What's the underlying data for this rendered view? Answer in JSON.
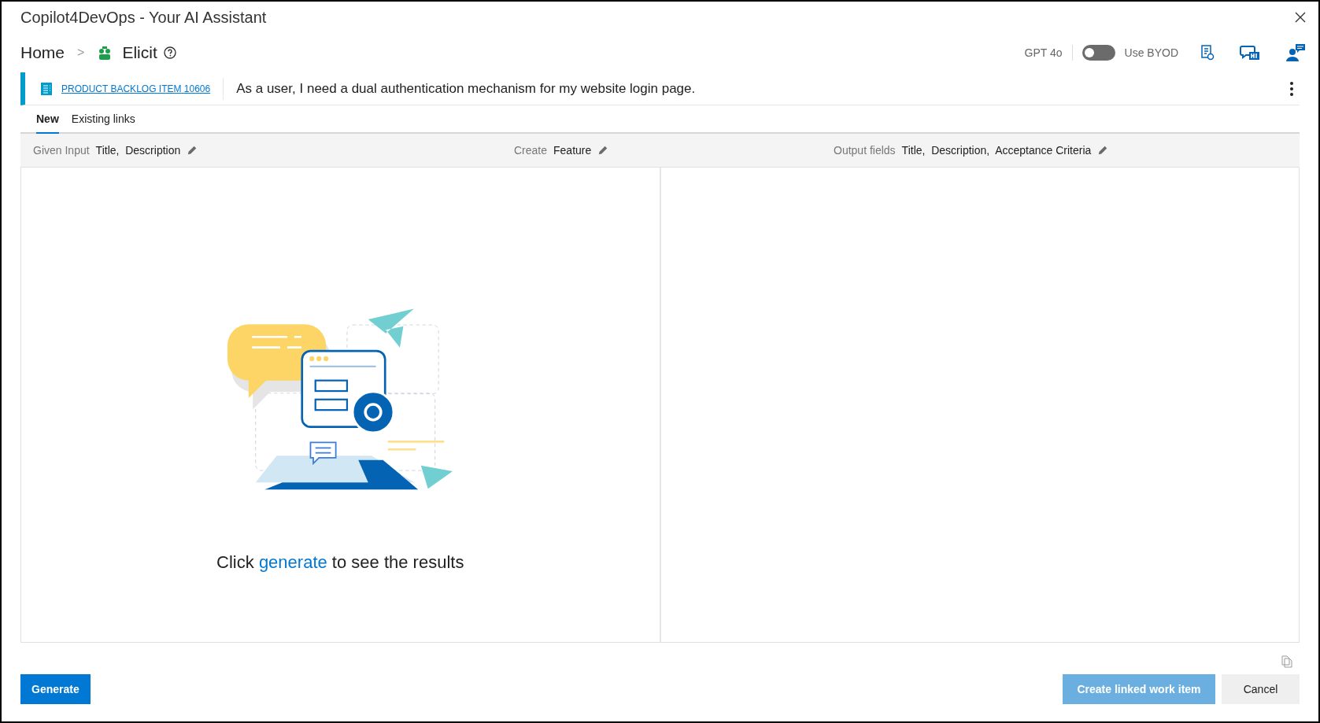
{
  "window": {
    "title": "Copilot4DevOps - Your AI Assistant"
  },
  "breadcrumb": {
    "home": "Home",
    "separator": ">",
    "current": "Elicit"
  },
  "header_right": {
    "model": "GPT 4o",
    "byod_toggle": {
      "on": false,
      "label": "Use BYOD"
    }
  },
  "work_item": {
    "link": "PRODUCT BACKLOG ITEM 10606",
    "title": "As a user, I need a dual authentication mechanism for my website login page."
  },
  "tabs": [
    {
      "label": "New",
      "selected": true
    },
    {
      "label": "Existing links",
      "selected": false
    }
  ],
  "config_bar": [
    {
      "label": "Given Input",
      "value": "Title,  Description"
    },
    {
      "label": "Create",
      "value": "Feature"
    },
    {
      "label": "Output fields",
      "value": "Title,  Description,  Acceptance Criteria"
    }
  ],
  "empty_state": {
    "before": "Click ",
    "link": "generate",
    "after": " to see the results"
  },
  "buttons": {
    "generate": "Generate",
    "create_linked": {
      "label": "Create linked work item",
      "disabled": true
    },
    "cancel": "Cancel"
  }
}
